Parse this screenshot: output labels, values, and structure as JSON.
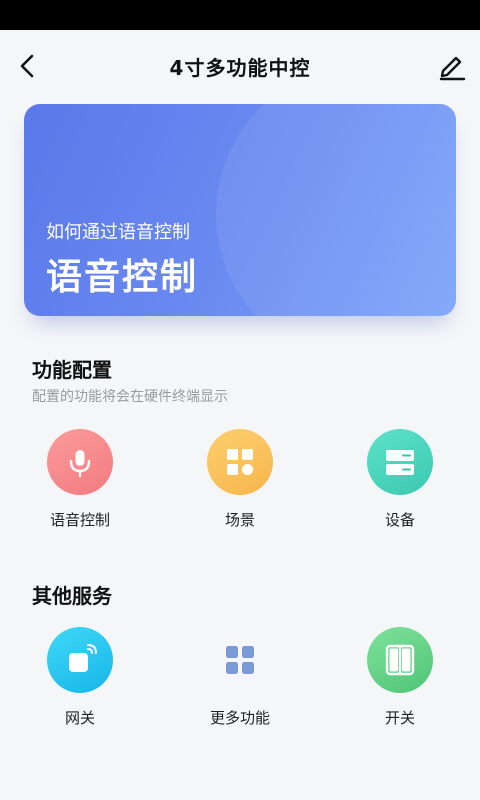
{
  "header": {
    "title": "4寸多功能中控",
    "back_icon": "chevron-left-icon",
    "edit_icon": "pencil-icon"
  },
  "banner": {
    "subtitle": "如何通过语音控制",
    "title": "语音控制"
  },
  "function_config": {
    "title": "功能配置",
    "subtitle": "配置的功能将会在硬件终端显示",
    "items": [
      {
        "label": "语音控制",
        "icon": "microphone-icon",
        "color": "#f48487"
      },
      {
        "label": "场景",
        "icon": "scene-grid-icon",
        "color": "#f8bf55"
      },
      {
        "label": "设备",
        "icon": "device-icon",
        "color": "#45d0b9"
      }
    ]
  },
  "other_services": {
    "title": "其他服务",
    "items": [
      {
        "label": "网关",
        "icon": "gateway-icon",
        "color": "#22c1ee"
      },
      {
        "label": "更多功能",
        "icon": "more-grid-icon",
        "color": "#7b99d6"
      },
      {
        "label": "开关",
        "icon": "switch-icon",
        "color": "#5acd80"
      }
    ]
  },
  "colors": {
    "banner_gradient_start": "#5b78e9",
    "banner_gradient_end": "#7ba4fb",
    "page_background": "#f5f6f8"
  }
}
